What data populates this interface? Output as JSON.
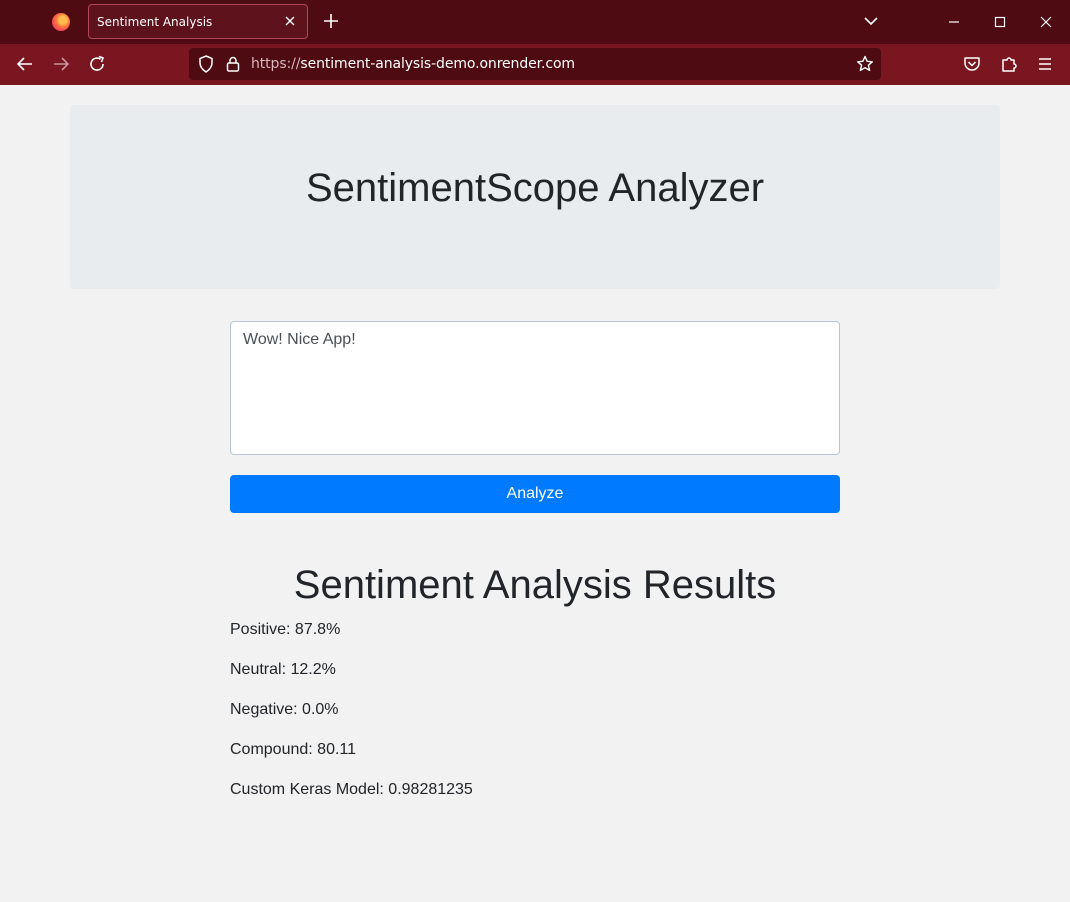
{
  "browser": {
    "tab_title": "Sentiment Analysis",
    "url_scheme": "https://",
    "url_host": "sentiment-analysis-demo.onrender.com",
    "icons": [
      "firefox-logo",
      "close-icon",
      "plus-icon",
      "chevron-down-icon",
      "minimize-icon",
      "maximize-icon",
      "close-icon",
      "back-arrow-icon",
      "forward-arrow-icon",
      "reload-icon",
      "shield-icon",
      "lock-icon",
      "star-icon",
      "pocket-icon",
      "extensions-icon",
      "menu-icon"
    ],
    "colors": {
      "tabbar": "#4e0b12",
      "toolbar": "#7a1620"
    }
  },
  "header": {
    "title": "SentimentScope Analyzer"
  },
  "form": {
    "input_value": "Wow! Nice App!",
    "button_label": "Analyze",
    "button_color": "#007bff"
  },
  "results": {
    "title": "Sentiment Analysis Results",
    "lines": [
      {
        "label": "Positive:",
        "value": "87.8%"
      },
      {
        "label": "Neutral:",
        "value": "12.2%"
      },
      {
        "label": "Negative:",
        "value": "0.0%"
      },
      {
        "label": "Compound:",
        "value": "80.11"
      },
      {
        "label": "Custom Keras Model:",
        "value": "0.98281235"
      }
    ]
  }
}
